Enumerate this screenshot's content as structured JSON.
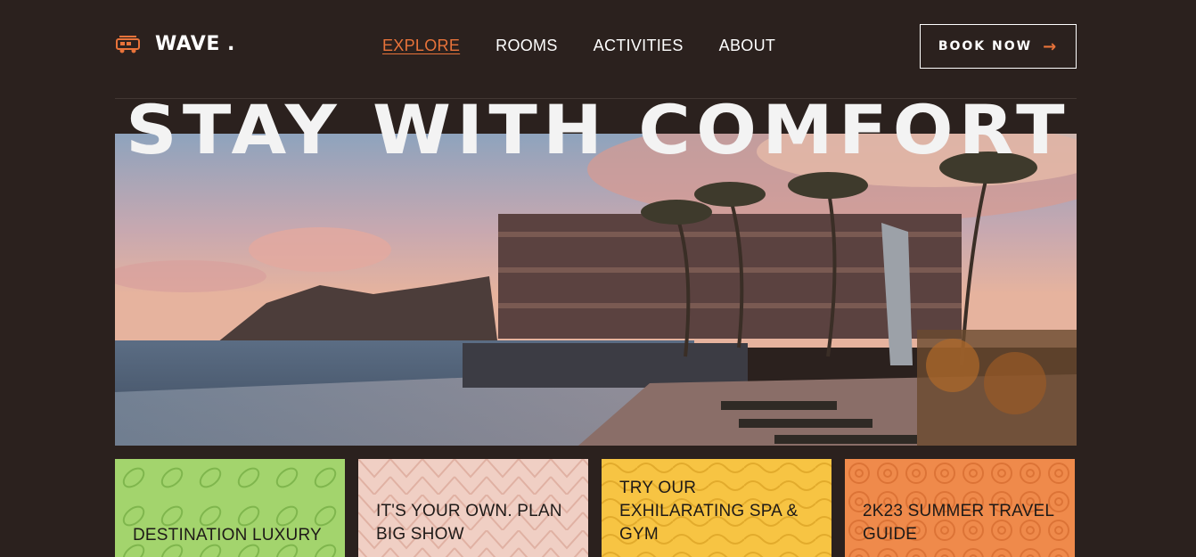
{
  "brand": {
    "name": "WAVE .",
    "icon": "van-icon"
  },
  "nav": {
    "items": [
      {
        "label": "EXPLORE",
        "active": true
      },
      {
        "label": "ROOMS",
        "active": false
      },
      {
        "label": "ACTIVITIES",
        "active": false
      },
      {
        "label": "ABOUT",
        "active": false
      }
    ]
  },
  "header": {
    "book_label": "BOOK NOW",
    "book_icon": "arrow-right-icon"
  },
  "hero": {
    "title": "STAY WITH COMFORT",
    "image": "resort-pool-at-sunset"
  },
  "cards": [
    {
      "text": "DESTINATION LUXURY",
      "color": "#a3d46d",
      "pattern": "leaf"
    },
    {
      "text": "IT'S YOUR OWN. PLAN BIG SHOW",
      "color": "#f0cfc4",
      "pattern": "chevron"
    },
    {
      "text": "TRY OUR EXHILARATING SPA & GYM",
      "color": "#f7c443",
      "pattern": "wave"
    },
    {
      "text": "2K23 SUMMER TRAVEL GUIDE",
      "color": "#ef8a4b",
      "pattern": "circle"
    }
  ],
  "colors": {
    "background": "#2b211e",
    "accent": "#e8733a",
    "text": "#ffffff"
  }
}
